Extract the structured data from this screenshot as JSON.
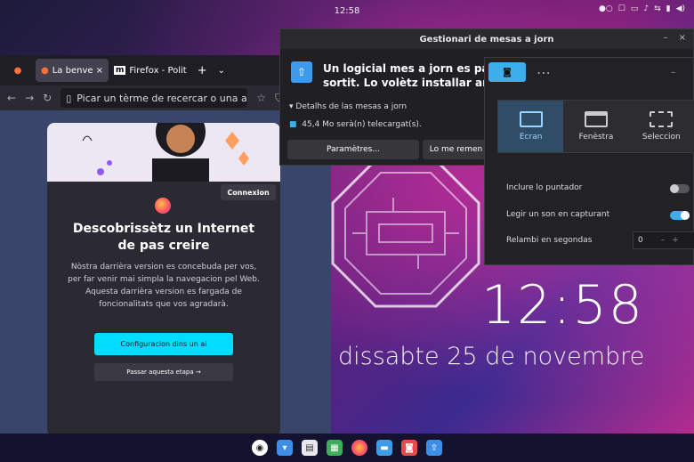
{
  "topbar": {
    "time": "12:58"
  },
  "lockscreen": {
    "clock": "12:58",
    "date": "dissabte 25 de novembre"
  },
  "firefox": {
    "tabs": [
      {
        "label": "La benveng",
        "close": "×"
      },
      {
        "label": "Firefox - Polit",
        "icon": "m"
      }
    ],
    "new_tab": "+",
    "tab_list": "⌄",
    "url_placeholder": "Picar un tèrme de recercar o una ad",
    "welcome": {
      "connexion": "Connexion",
      "title_line1": "Descobrissètz un Internet",
      "title_line2": "de pas creire",
      "text": "Nòstra darrièra version es concebuda per vos, per far venir mai simpla la navegacion pel Web. Aquesta darrièra version es fargada de foncionalitats que vos agradarà.",
      "primary": "Configuracion dins un ai",
      "secondary": "Passar aquesta etapa →"
    }
  },
  "updater": {
    "title": "Gestionari de mesas a jorn",
    "min": "–",
    "close": "×",
    "message_line1": "Un logicial mes a jorn es paregu",
    "message_line2": "sortit. Lo volètz installar ara ?",
    "details": "Detalhs de las mesas a jorn",
    "size": "45,4 Mo serà(n) telecargat(s).",
    "btn_params": "Paramètres...",
    "btn_remind": "Lo me remen"
  },
  "screenshot": {
    "more": "⋯",
    "min": "–",
    "modes": [
      {
        "label": "Ecran"
      },
      {
        "label": "Fenèstra"
      },
      {
        "label": "Seleccion"
      }
    ],
    "opt_pointer": "Inclure lo puntador",
    "opt_sound": "Legir un son en capturant",
    "opt_delay": "Relambi en segondas",
    "delay_value": "0",
    "delay_minus": "–",
    "delay_plus": "+",
    "pointer_on": false,
    "sound_on": true
  },
  "colors": {
    "accent": "#3daee9",
    "firefox_cta": "#00ddff"
  }
}
